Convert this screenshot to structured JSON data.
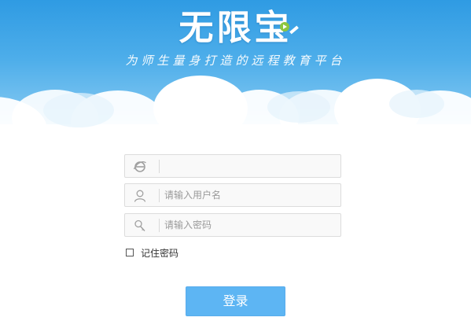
{
  "brand": {
    "title": "无限宝",
    "slogan": "为师生量身打造的远程教育平台"
  },
  "form": {
    "server": {
      "icon": "ie-browser-icon",
      "value": "",
      "placeholder": ""
    },
    "username": {
      "icon": "user-icon",
      "value": "",
      "placeholder": "请输入用户名"
    },
    "password": {
      "icon": "key-icon",
      "value": "",
      "placeholder": "请输入密码"
    },
    "remember": {
      "label": "记住密码",
      "checked": false
    },
    "login_label": "登录"
  },
  "colors": {
    "sky_top": "#2f9be3",
    "sky_bottom": "#a9d9f6",
    "button": "#5db5f3"
  }
}
